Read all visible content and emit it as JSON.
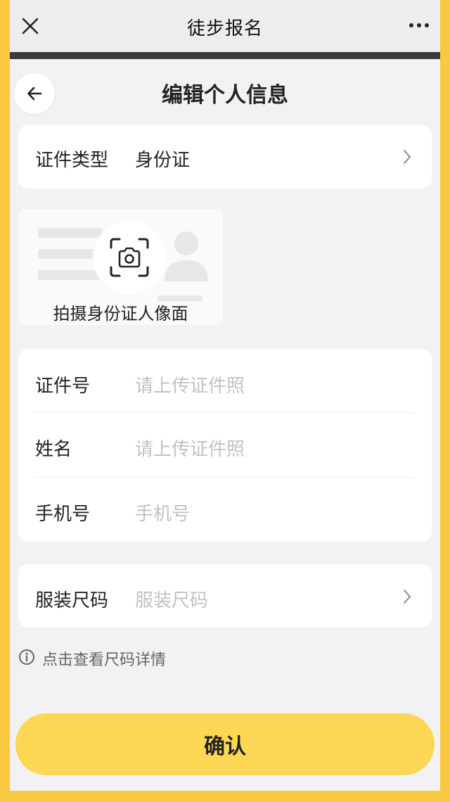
{
  "topbar": {
    "title": "徒步报名",
    "close_icon": "close-icon",
    "more_icon": "more-icon"
  },
  "page": {
    "title": "编辑个人信息",
    "back_icon": "arrow-left-icon"
  },
  "id_type": {
    "label": "证件类型",
    "value": "身份证"
  },
  "id_photo": {
    "label": "拍摄身份证人像面",
    "icon": "camera-icon"
  },
  "form": {
    "id_number": {
      "label": "证件号",
      "placeholder": "请上传证件照"
    },
    "name": {
      "label": "姓名",
      "placeholder": "请上传证件照"
    },
    "phone": {
      "label": "手机号",
      "placeholder": "手机号"
    }
  },
  "size": {
    "label": "服装尺码",
    "placeholder": "服装尺码"
  },
  "size_info": {
    "text": "点击查看尺码详情",
    "icon": "info-icon"
  },
  "confirm": {
    "label": "确认"
  },
  "colors": {
    "accent": "#fbd753",
    "border": "#f9c941",
    "background": "#f2f2f4",
    "placeholder": "#c2c2c2"
  }
}
